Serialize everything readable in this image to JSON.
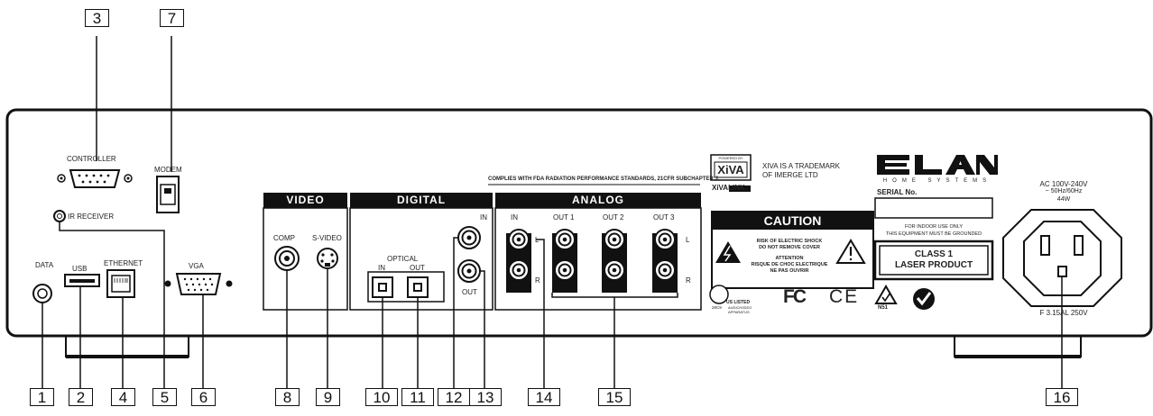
{
  "labels": {
    "controller": "CONTROLLER",
    "modem": "MODEM",
    "ir_receiver": "IR RECEIVER",
    "data": "DATA",
    "usb": "USB",
    "ethernet": "ETHERNET",
    "vga": "VGA",
    "comp": "COMP",
    "svideo": "S-VIDEO",
    "optical": "OPTICAL",
    "opt_in": "IN",
    "opt_out": "OUT",
    "coax_in": "IN",
    "coax_out": "OUT",
    "analog_in": "IN",
    "out1": "OUT 1",
    "out2": "OUT 2",
    "out3": "OUT 3",
    "l": "L",
    "r": "R"
  },
  "sections": {
    "video": "VIDEO",
    "digital": "DIGITAL",
    "analog": "ANALOG"
  },
  "fda_notice": "COMPLIES WITH FDA RADIATION PERFORMANCE STANDARDS, 21CFR SUBCHAPTER J.",
  "xiva": {
    "powered_by": "POWERED BY",
    "logo": "XiVA",
    "link_logo": "XiVALINK",
    "trademark_1": "XIVA IS A TRADEMARK",
    "trademark_2": "OF IMERGE LTD"
  },
  "elan": {
    "logo": "ELAN",
    "tagline": "HOME  SYSTEMS",
    "serial_label": "SERIAL No.",
    "indoor_1": "FOR INDOOR USE ONLY",
    "indoor_2": "THIS EQUIPMENT MUST BE GROUNDED",
    "laser_1": "CLASS 1",
    "laser_2": "LASER PRODUCT"
  },
  "caution": {
    "title": "CAUTION",
    "line_1": "RISK OF ELECTRIC SHOCK",
    "line_2": "DO NOT REMOVE COVER",
    "line_3": "ATTENTION",
    "line_4": "RISQUE DE CHOC ELECTRIQUE",
    "line_5": "NE PAS OUVRIR"
  },
  "certifications": {
    "ul_listed": "US LISTED",
    "ul_sub_1": "AUDIO/VIDEO",
    "ul_sub_2": "APPARATUS",
    "ul_code": "28C9",
    "fcc": "FC",
    "ce": "CE",
    "n51": "N51"
  },
  "power": {
    "line_1": "AC 100V-240V",
    "line_2": "~ 50Hz/60Hz",
    "line_3": "44W",
    "fuse": "F 3.15AL 250V"
  },
  "callouts": [
    "1",
    "2",
    "3",
    "4",
    "5",
    "6",
    "7",
    "8",
    "9",
    "10",
    "11",
    "12",
    "13",
    "14",
    "15",
    "16"
  ]
}
